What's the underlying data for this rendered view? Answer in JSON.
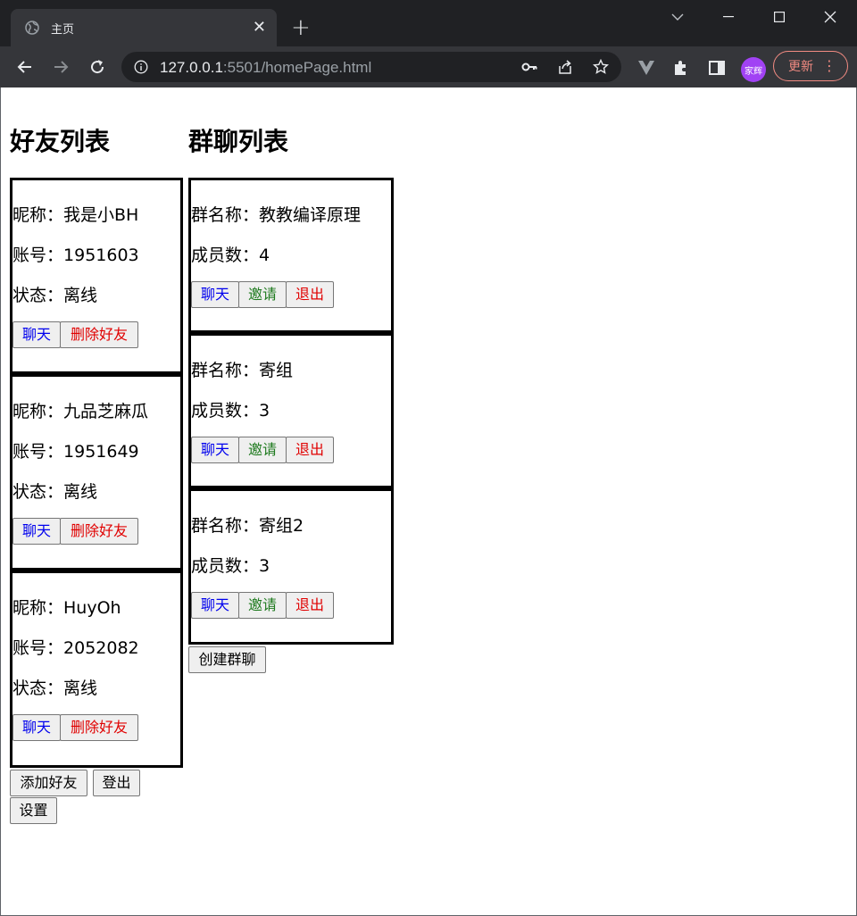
{
  "browser": {
    "tab_title": "主页",
    "tab_close": "✕",
    "new_tab": "+",
    "url_host": "127.0.0.1",
    "url_rest": ":5501/homePage.html",
    "profile_name": "家辉",
    "update_label": "更新",
    "menu_dots": "⋮"
  },
  "friends": {
    "heading": "好友列表",
    "nickname_label": "昵称：",
    "account_label": "账号：",
    "status_label": "状态：",
    "chat_label": "聊天",
    "delete_label": "删除好友",
    "items": [
      {
        "nickname": "我是小BH",
        "account": "1951603",
        "status": "离线"
      },
      {
        "nickname": "九品芝麻瓜",
        "account": "1951649",
        "status": "离线"
      },
      {
        "nickname": "HuyOh",
        "account": "2052082",
        "status": "离线"
      }
    ],
    "add_label": "添加好友",
    "logout_label": "登出",
    "settings_label": "设置"
  },
  "groups": {
    "heading": "群聊列表",
    "name_label": "群名称：",
    "members_label": "成员数：",
    "chat_label": "聊天",
    "invite_label": "邀请",
    "quit_label": "退出",
    "items": [
      {
        "name": "教教编译原理",
        "members": "4"
      },
      {
        "name": "寄组",
        "members": "3"
      },
      {
        "name": "寄组2",
        "members": "3"
      }
    ],
    "create_label": "创建群聊"
  },
  "colors": {
    "chat": "#0000ee",
    "invite": "#1e7a1e",
    "danger": "#e00000",
    "browser_frame": "#202124",
    "browser_toolbar": "#35363a",
    "update_accent": "#f28b82",
    "avatar": "#a142f4"
  }
}
